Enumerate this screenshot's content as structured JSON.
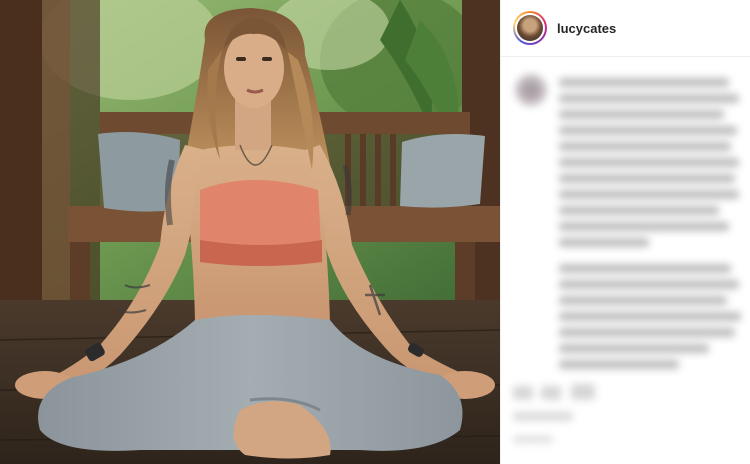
{
  "post": {
    "username": "lucycates",
    "image_description_icon": "yoga-photo"
  },
  "colors": {
    "panel_bg": "#ffffff",
    "divider": "#efefef",
    "username_text": "#262626",
    "avatar_ring": "#dd2a7b"
  }
}
